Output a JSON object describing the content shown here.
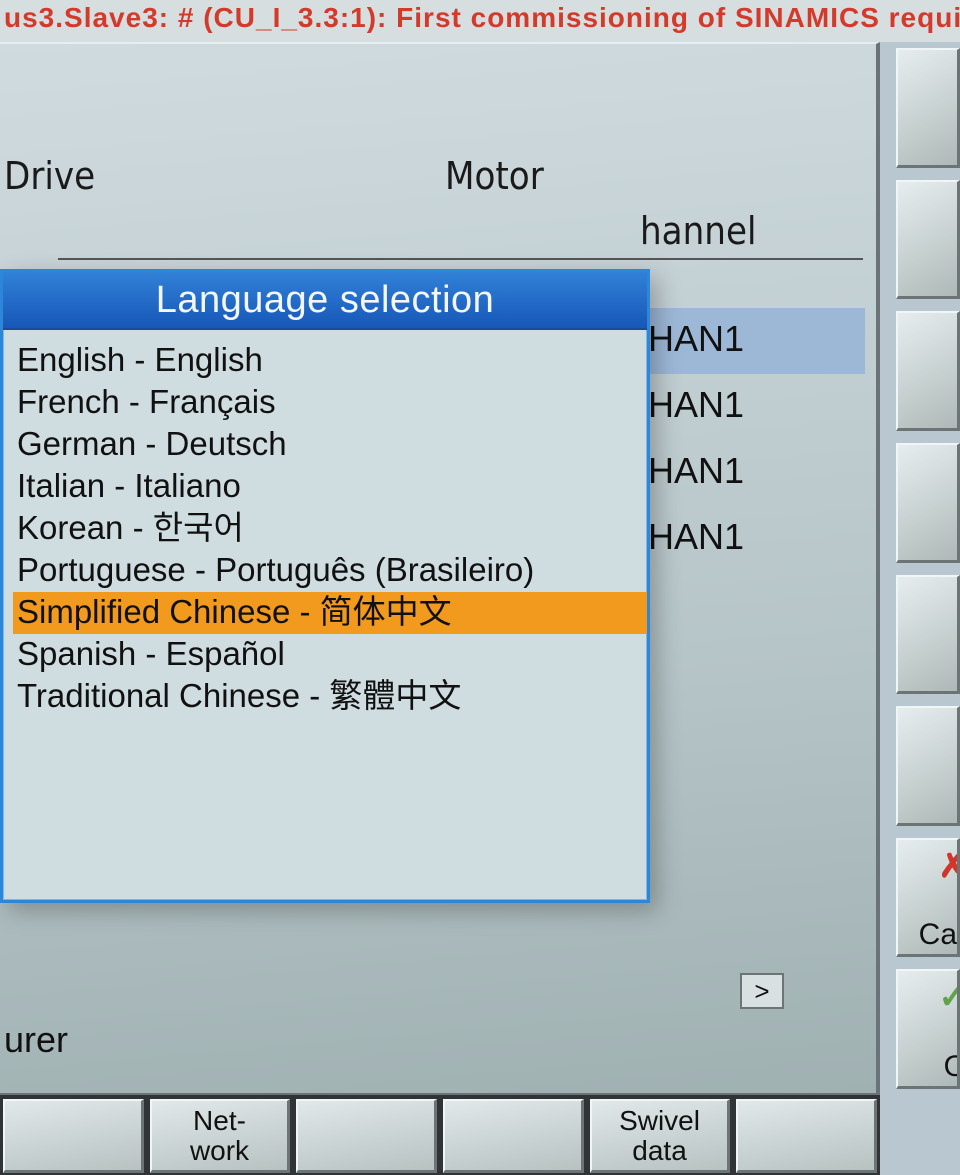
{
  "status_message": "us3.Slave3: # (CU_I_3.3:1): First commissioning of SINAMICS required!",
  "headers": {
    "drive": "Drive",
    "motor": "Motor",
    "channel": "hannel"
  },
  "channels": [
    {
      "text": "HAN1",
      "selected": true
    },
    {
      "text": "HAN1",
      "selected": false
    },
    {
      "text": "HAN1",
      "selected": false
    },
    {
      "text": "HAN1",
      "selected": false
    }
  ],
  "partial_label": "urer",
  "dialog": {
    "title": "Language selection",
    "items": [
      {
        "label": "English - English",
        "selected": false
      },
      {
        "label": "French - Français",
        "selected": false
      },
      {
        "label": "German - Deutsch",
        "selected": false
      },
      {
        "label": "Italian - Italiano",
        "selected": false
      },
      {
        "label": "Korean - 한국어",
        "selected": false
      },
      {
        "label": "Portuguese - Português (Brasileiro)",
        "selected": false
      },
      {
        "label": "Simplified Chinese - 简体中文",
        "selected": true
      },
      {
        "label": "Spanish - Español",
        "selected": false
      },
      {
        "label": "Traditional Chinese - 繁體中文",
        "selected": false
      }
    ]
  },
  "softkeys_right": [
    {
      "label": "",
      "icon": ""
    },
    {
      "label": "",
      "icon": ""
    },
    {
      "label": "",
      "icon": ""
    },
    {
      "label": "",
      "icon": ""
    },
    {
      "label": "",
      "icon": ""
    },
    {
      "label": "",
      "icon": ""
    },
    {
      "label": "Car",
      "icon": "✗",
      "icon_class": "icon-cancel"
    },
    {
      "label": "O",
      "icon": "✓",
      "icon_class": "icon-ok"
    }
  ],
  "softkeys_bottom": [
    {
      "label": ""
    },
    {
      "label": "Net-\nwork"
    },
    {
      "label": ""
    },
    {
      "label": ""
    },
    {
      "label": "Swivel\ndata"
    },
    {
      "label": ""
    }
  ],
  "scroll_indicator": ">"
}
